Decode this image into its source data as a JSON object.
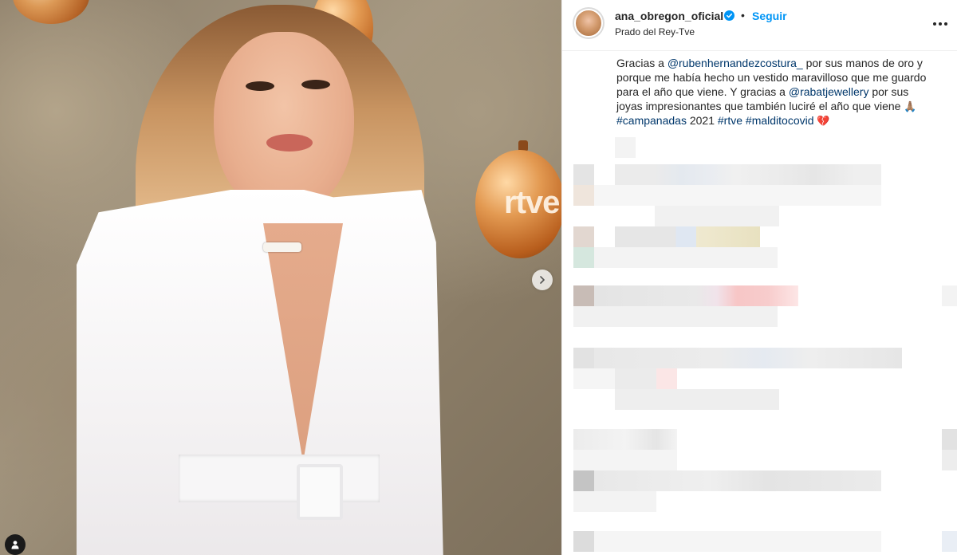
{
  "post": {
    "username": "ana_obregon_oficial",
    "separator": "•",
    "follow_label": "Seguir",
    "location": "Prado del Rey-Tve",
    "photo_watermark": "rtve"
  },
  "caption": {
    "text_1": "Gracias a ",
    "mention_1": "@rubenhernandezcostura_",
    "text_2": " por sus manos de oro y porque me había hecho un vestido maravilloso que me guardo para el año que viene. Y gracias a ",
    "mention_2": "@rabatjewellery",
    "text_3": " por sus joyas impresionantes que también luciré el año que viene ",
    "emoji_pray": "🙏🏽",
    "hashtag_1": "#campanadas",
    "text_4": " 2021 ",
    "hashtag_2": "#rtve",
    "hashtag_3": "#malditocovid",
    "emoji_heart": "💔"
  },
  "icons": {
    "verified": "verified-badge-icon",
    "more": "more-options-icon",
    "next": "chevron-right-icon",
    "tags": "user-tag-icon"
  },
  "colors": {
    "accent": "#0095f6",
    "link": "#00376b",
    "text": "#262626",
    "border": "#efefef"
  }
}
